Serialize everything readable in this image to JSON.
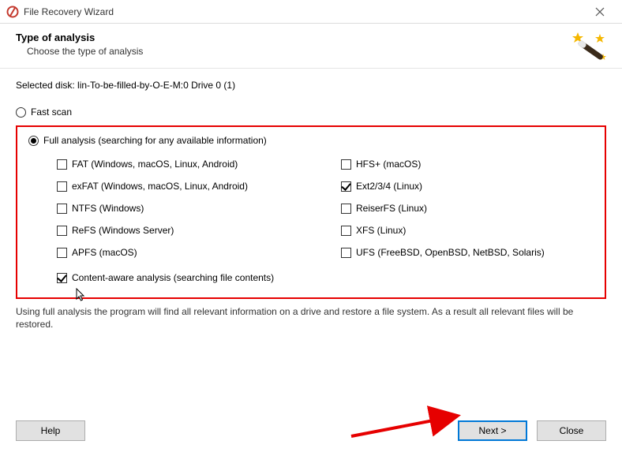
{
  "window": {
    "title": "File Recovery Wizard"
  },
  "header": {
    "title": "Type of analysis",
    "subtitle": "Choose the type of analysis"
  },
  "selected_disk_label": "Selected disk: lin-To-be-filled-by-O-E-M:0 Drive 0 (1)",
  "scan_modes": {
    "fast": {
      "label": "Fast scan",
      "selected": false
    },
    "full": {
      "label": "Full analysis (searching for any available information)",
      "selected": true
    }
  },
  "filesystems": {
    "left": [
      {
        "id": "fat",
        "label": "FAT (Windows, macOS, Linux, Android)",
        "checked": false
      },
      {
        "id": "exfat",
        "label": "exFAT (Windows, macOS, Linux, Android)",
        "checked": false
      },
      {
        "id": "ntfs",
        "label": "NTFS (Windows)",
        "checked": false
      },
      {
        "id": "refs",
        "label": "ReFS (Windows Server)",
        "checked": false
      },
      {
        "id": "apfs",
        "label": "APFS (macOS)",
        "checked": false
      }
    ],
    "right": [
      {
        "id": "hfsplus",
        "label": "HFS+ (macOS)",
        "checked": false
      },
      {
        "id": "ext",
        "label": "Ext2/3/4 (Linux)",
        "checked": true
      },
      {
        "id": "reiserfs",
        "label": "ReiserFS (Linux)",
        "checked": false
      },
      {
        "id": "xfs",
        "label": "XFS (Linux)",
        "checked": false
      },
      {
        "id": "ufs",
        "label": "UFS (FreeBSD, OpenBSD, NetBSD, Solaris)",
        "checked": false
      }
    ]
  },
  "content_aware": {
    "label": "Content-aware analysis (searching file contents)",
    "checked": true
  },
  "description": "Using full analysis the program will find all relevant information on a drive and restore a file system. As a result all relevant files will be restored.",
  "buttons": {
    "help": "Help",
    "next": "Next >",
    "close": "Close"
  }
}
